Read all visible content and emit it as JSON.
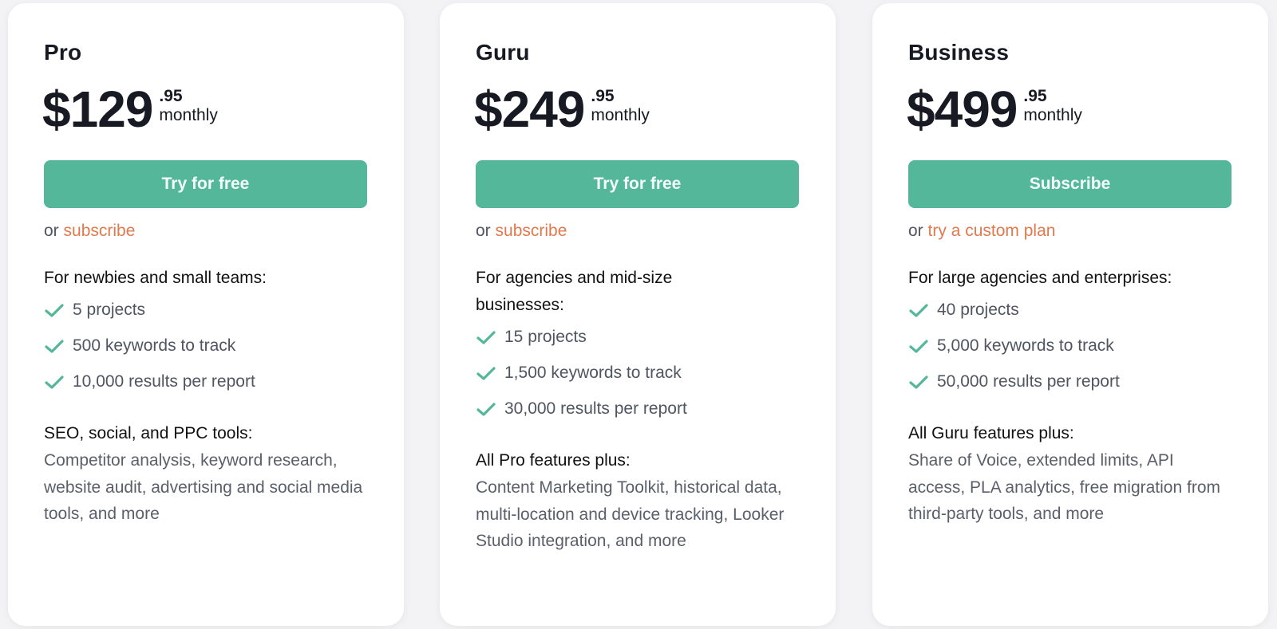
{
  "theme": {
    "accent": "#55b79a",
    "link": "#e07a4e",
    "check": "#55b79a"
  },
  "plans": [
    {
      "name": "Pro",
      "price_whole": "$129",
      "price_cents": ".95",
      "period": "monthly",
      "cta_label": "Try for free",
      "alt_prefix": "or",
      "alt_link": "subscribe",
      "audience": "For newbies and small teams:",
      "features": [
        "5 projects",
        "500 keywords to track",
        "10,000 results per report"
      ],
      "extras_title": "SEO, social, and PPC tools:",
      "extras_text": "Competitor analysis, keyword research, website audit, advertising and social media tools, and more"
    },
    {
      "name": "Guru",
      "price_whole": "$249",
      "price_cents": ".95",
      "period": "monthly",
      "cta_label": "Try for free",
      "alt_prefix": "or",
      "alt_link": "subscribe",
      "audience": "For agencies and mid-size businesses:",
      "features": [
        "15 projects",
        "1,500 keywords to track",
        "30,000 results per report"
      ],
      "extras_title": "All Pro features plus:",
      "extras_text": "Content Marketing Toolkit, historical data, multi-location and device tracking, Looker Studio integration, and more"
    },
    {
      "name": "Business",
      "price_whole": "$499",
      "price_cents": ".95",
      "period": "monthly",
      "cta_label": "Subscribe",
      "alt_prefix": "or",
      "alt_link": "try a custom plan",
      "audience": "For large agencies and enterprises:",
      "features": [
        "40 projects",
        "5,000 keywords to track",
        "50,000 results per report"
      ],
      "extras_title": "All Guru features plus:",
      "extras_text": "Share of Voice, extended limits, API access, PLA analytics, free migration from third-party tools, and more"
    }
  ]
}
